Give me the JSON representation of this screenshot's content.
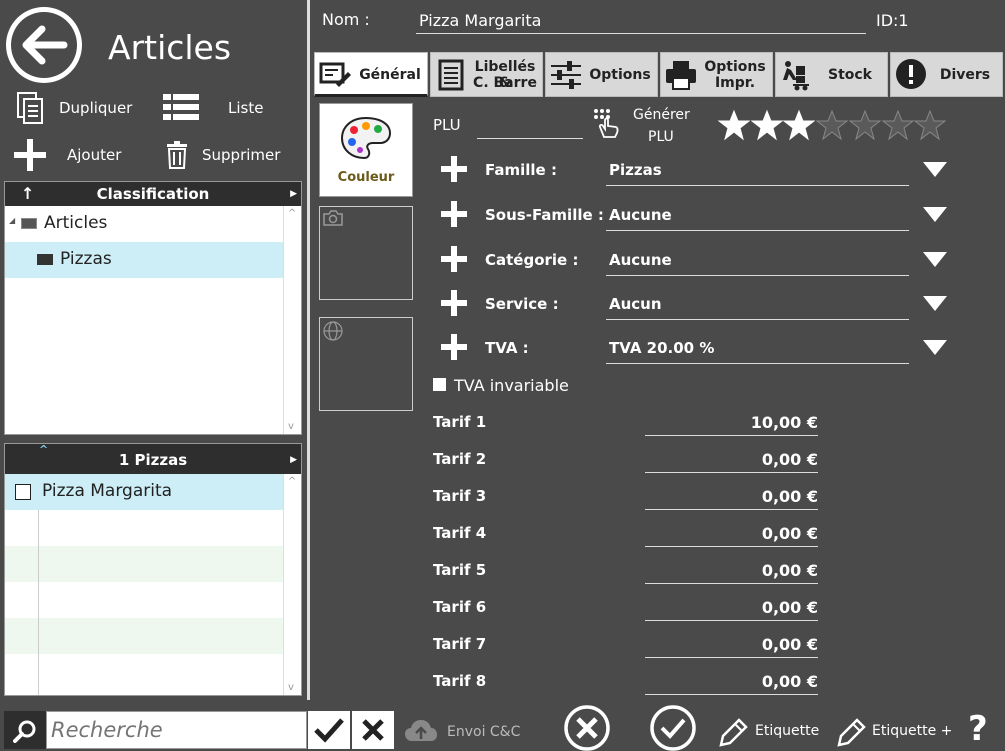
{
  "left": {
    "title": "Articles",
    "actions": {
      "duplicate": "Dupliquer",
      "list": "Liste",
      "add": "Ajouter",
      "delete": "Supprimer"
    },
    "classification": {
      "header": "Classification",
      "items": [
        {
          "label": "Articles",
          "selected": false
        },
        {
          "label": "Pizzas",
          "selected": true
        }
      ]
    },
    "products": {
      "header": "1 Pizzas",
      "items": [
        {
          "label": "Pizza Margarita",
          "selected": true
        }
      ]
    },
    "search": {
      "placeholder": "Recherche"
    }
  },
  "form": {
    "name_label": "Nom :",
    "name_value": "Pizza Margarita",
    "id_label": "ID:1",
    "tabs": [
      {
        "label": "Général",
        "active": true
      },
      {
        "label": "Libellés &",
        "label2": "C. Barre"
      },
      {
        "label": "Options"
      },
      {
        "label": "Options",
        "label2": "Impr."
      },
      {
        "label": "Stock"
      },
      {
        "label": "Divers"
      }
    ],
    "image_caption": "Couleur",
    "plu_label": "PLU",
    "plu_value": "",
    "generate_plu": "Générer",
    "generate_plu2": "PLU",
    "rating": 3,
    "rating_max": 7,
    "fields": [
      {
        "label": "Famille :",
        "value": "Pizzas"
      },
      {
        "label": "Sous-Famille :",
        "value": "Aucune"
      },
      {
        "label": "Catégorie :",
        "value": "Aucune"
      },
      {
        "label": "Service :",
        "value": "Aucun"
      },
      {
        "label": "TVA :",
        "value": "TVA 20.00 %"
      }
    ],
    "tva_invariable": "TVA invariable",
    "tarifs": [
      {
        "label": "Tarif 1",
        "value": "10,00 €"
      },
      {
        "label": "Tarif 2",
        "value": "0,00 €"
      },
      {
        "label": "Tarif 3",
        "value": "0,00 €"
      },
      {
        "label": "Tarif 4",
        "value": "0,00 €"
      },
      {
        "label": "Tarif 5",
        "value": "0,00 €"
      },
      {
        "label": "Tarif 6",
        "value": "0,00 €"
      },
      {
        "label": "Tarif 7",
        "value": "0,00 €"
      },
      {
        "label": "Tarif 8",
        "value": "0,00 €"
      }
    ]
  },
  "bottom": {
    "send_cc": "Envoi C&C",
    "label": "Etiquette",
    "label_plus": "Etiquette +",
    "help": "?"
  },
  "colors": {
    "background": "#4a4a4a",
    "selected_row": "#cdeef7",
    "header": "#2e2e2e"
  }
}
